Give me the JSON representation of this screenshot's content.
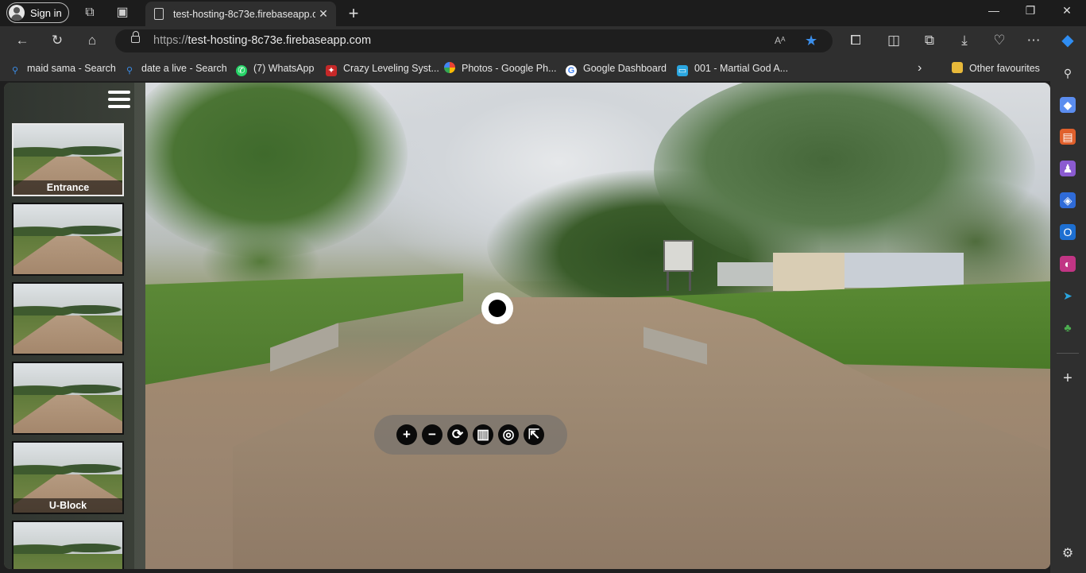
{
  "browser": {
    "signin_label": "Sign in",
    "tab_title": "test-hosting-8c73e.firebaseapp.c",
    "tab_close": "✕",
    "new_tab": "+",
    "url_scheme": "https://",
    "url_host": "test-hosting-8c73e.firebaseapp.com",
    "read_aloud": "Aᴬ",
    "window_controls": [
      "—",
      "❐",
      "✕"
    ]
  },
  "favourites": [
    {
      "label": "maid sama - Search",
      "icon": "search-icon",
      "color": "#3b8eea"
    },
    {
      "label": "date a live - Search",
      "icon": "search-icon",
      "color": "#3b8eea"
    },
    {
      "label": "(7) WhatsApp",
      "icon": "whatsapp-icon",
      "color": "#25d366"
    },
    {
      "label": "Crazy Leveling Syst...",
      "icon": "book-icon",
      "color": "#c62828"
    },
    {
      "label": "Photos - Google Ph...",
      "icon": "photos-icon",
      "color": "#fbbc05"
    },
    {
      "label": "Google Dashboard",
      "icon": "google-icon",
      "color": "#ffffff"
    },
    {
      "label": "001 - Martial God A...",
      "icon": "bilibili-icon",
      "color": "#2aa6e0"
    }
  ],
  "other_favourites": "Other favourites",
  "tour": {
    "scenes": [
      {
        "caption": "Entrance",
        "active": true
      },
      {
        "caption": "",
        "active": false
      },
      {
        "caption": "",
        "active": false
      },
      {
        "caption": "",
        "active": false
      },
      {
        "caption": "U-Block",
        "active": false
      },
      {
        "caption": "",
        "active": false
      }
    ],
    "controls": [
      {
        "name": "zoom-in-button",
        "glyph": "+"
      },
      {
        "name": "zoom-out-button",
        "glyph": "−"
      },
      {
        "name": "autorotate-button",
        "glyph": "⟳"
      },
      {
        "name": "map-button",
        "glyph": "▥"
      },
      {
        "name": "gyroscope-button",
        "glyph": "◎"
      },
      {
        "name": "fullscreen-button",
        "glyph": "⇱"
      }
    ]
  },
  "colors": {
    "accent": "#3b8eea",
    "chrome_dark": "#1c1c1c",
    "chrome": "#2f2f2f"
  }
}
